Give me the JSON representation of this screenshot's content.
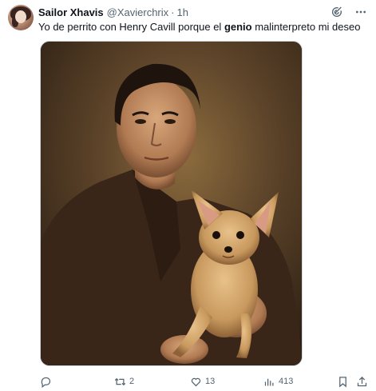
{
  "tweet": {
    "author_name": "Sailor Xhavis",
    "author_handle": "@Xavierchrix",
    "separator": "·",
    "time": "1h",
    "text_before": "Yo de perrito con Henry Cavill porque el ",
    "text_bold": "genio",
    "text_after": " malinterpreto mi deseo"
  },
  "media": {
    "description_icon": "portrait-image"
  },
  "actions": {
    "reply_count": "",
    "retweet_count": "2",
    "like_count": "13",
    "views_count": "413"
  },
  "colors": {
    "text": "#0f1419",
    "muted": "#536471",
    "border": "#cfd9de"
  }
}
